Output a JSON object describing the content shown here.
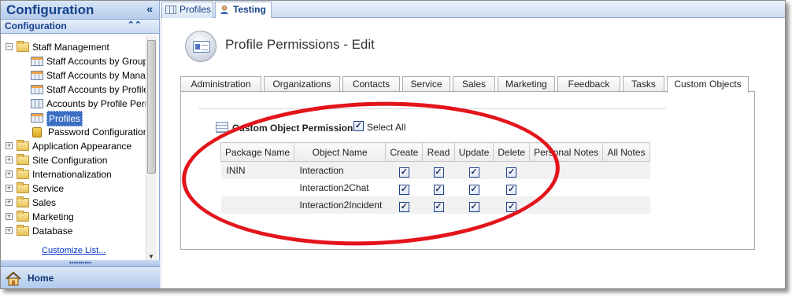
{
  "nav": {
    "title": "Configuration",
    "collapse_glyph": "«",
    "subheader": "Configuration",
    "subheader_glyph": "⌃⌃",
    "tree": [
      {
        "label": "Staff Management",
        "icon": "folder-icon",
        "expander": "−",
        "level": 0
      },
      {
        "label": "Staff Accounts by Group",
        "icon": "report-grid-icon",
        "level": 1
      },
      {
        "label": "Staff Accounts by Manage",
        "icon": "report-grid-icon",
        "level": 1
      },
      {
        "label": "Staff Accounts by Profile",
        "icon": "report-grid-icon",
        "level": 1
      },
      {
        "label": "Accounts by Profile Permis",
        "icon": "grid-icon",
        "level": 1
      },
      {
        "label": "Profiles",
        "icon": "report-grid-icon",
        "level": 1,
        "selected": true
      },
      {
        "label": "Password Configuration",
        "icon": "lock-icon",
        "level": 1
      },
      {
        "label": "Application Appearance",
        "icon": "folder-icon",
        "expander": "+",
        "level": 0
      },
      {
        "label": "Site Configuration",
        "icon": "folder-icon",
        "expander": "+",
        "level": 0
      },
      {
        "label": "Internationalization",
        "icon": "folder-icon",
        "expander": "+",
        "level": 0
      },
      {
        "label": "Service",
        "icon": "folder-icon",
        "expander": "+",
        "level": 0
      },
      {
        "label": "Sales",
        "icon": "folder-icon",
        "expander": "+",
        "level": 0
      },
      {
        "label": "Marketing",
        "icon": "folder-icon",
        "expander": "+",
        "level": 0
      },
      {
        "label": "Database",
        "icon": "folder-icon",
        "expander": "+",
        "level": 0
      }
    ],
    "customize_link": "Customize List...",
    "splitter_glyph": "••••••••••",
    "home_label": "Home"
  },
  "doc_tabs": [
    {
      "label": "Profiles",
      "icon": "grid-icon",
      "active": false
    },
    {
      "label": "Testing",
      "icon": "user-icon",
      "active": true
    }
  ],
  "page": {
    "title": "Profile Permissions - Edit"
  },
  "permission_tabs": [
    {
      "label": "Administration",
      "active": false
    },
    {
      "label": "Organizations",
      "active": false
    },
    {
      "label": "Contacts",
      "active": false
    },
    {
      "label": "Service",
      "active": false
    },
    {
      "label": "Sales",
      "active": false
    },
    {
      "label": "Marketing",
      "active": false
    },
    {
      "label": "Feedback",
      "active": false
    },
    {
      "label": "Tasks",
      "active": false
    },
    {
      "label": "Custom Objects",
      "active": true
    }
  ],
  "custom_objects": {
    "section_title": "Custom Object Permissions",
    "select_all_label": "Select All",
    "select_all_checked": true,
    "columns": [
      "Package Name",
      "Object Name",
      "Create",
      "Read",
      "Update",
      "Delete",
      "Personal Notes",
      "All Notes"
    ],
    "rows": [
      {
        "package": "ININ",
        "object": "Interaction",
        "create": true,
        "read": true,
        "update": true,
        "delete": true
      },
      {
        "package": "",
        "object": "Interaction2Chat",
        "create": true,
        "read": true,
        "update": true,
        "delete": true
      },
      {
        "package": "",
        "object": "Interaction2Incident",
        "create": true,
        "read": true,
        "update": true,
        "delete": true
      }
    ]
  },
  "colors": {
    "accent": "#15428b",
    "annotation": "#e3141b",
    "selection": "#3a6fc4"
  },
  "checkmark_glyph": "✓"
}
